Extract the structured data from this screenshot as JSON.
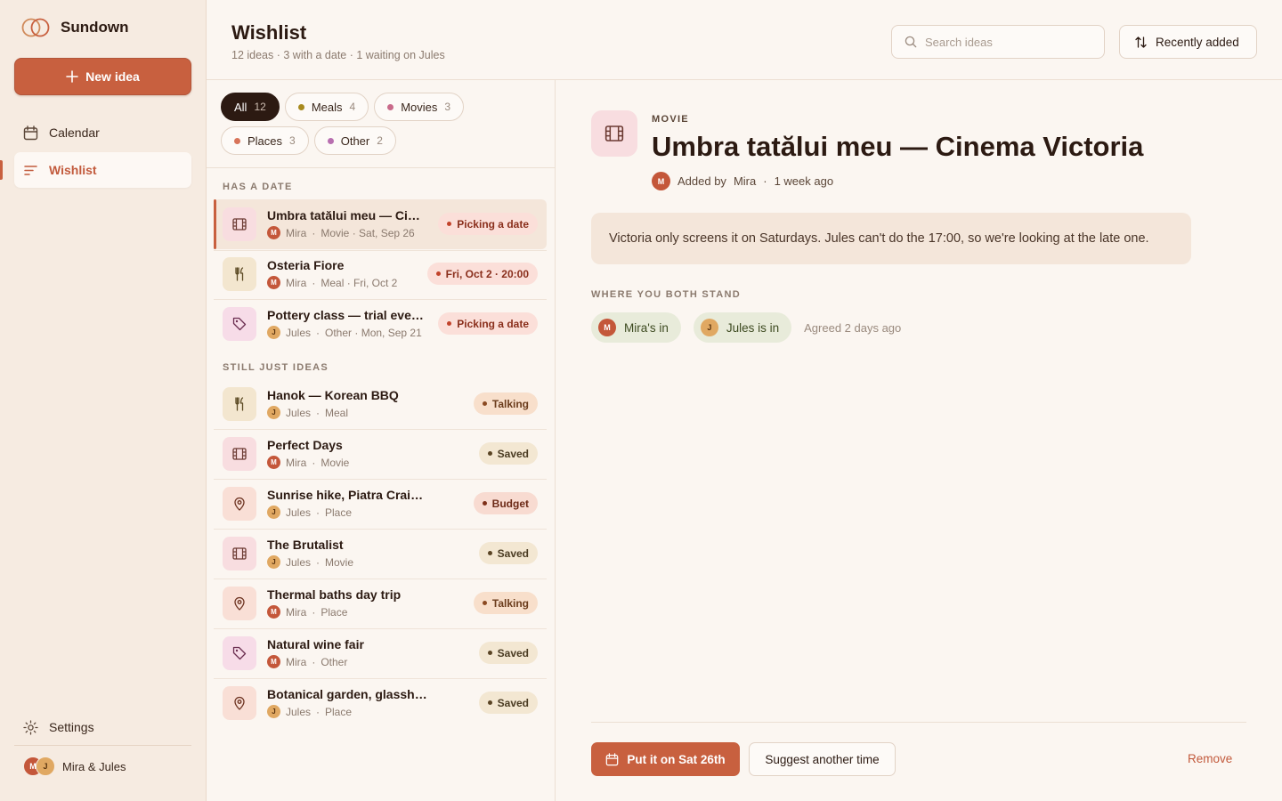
{
  "app": {
    "name": "Sundown"
  },
  "sidebar": {
    "new_button": "New idea",
    "items": [
      {
        "label": "Calendar",
        "icon": "calendar-icon"
      },
      {
        "label": "Wishlist",
        "icon": "list-icon",
        "active": true
      }
    ],
    "settings": "Settings",
    "profile": {
      "name": "Mira & Jules",
      "initials": [
        "M",
        "J"
      ]
    }
  },
  "header": {
    "title": "Wishlist",
    "subtitle": "12 ideas · 3 with a date · 1 waiting on Jules",
    "search_placeholder": "Search ideas",
    "sort_label": "Recently added"
  },
  "filters": [
    {
      "label": "All",
      "count": "12",
      "active": true
    },
    {
      "label": "Meals",
      "count": "4",
      "color": "#a88a1e"
    },
    {
      "label": "Movies",
      "count": "3",
      "color": "#c96a8a"
    },
    {
      "label": "Places",
      "count": "3",
      "color": "#d8745a"
    },
    {
      "label": "Other",
      "count": "2",
      "color": "#b86fb0"
    }
  ],
  "sections": {
    "dated": "HAS A DATE",
    "ideas": "STILL JUST IDEAS"
  },
  "dated_items": [
    {
      "title": "Umbra tatălui meu — Cinema Victoria",
      "initial": "M",
      "who": "Mira",
      "detail": "Movie · Sat, Sep 26",
      "badge": "Picking a date",
      "kind": "movie",
      "selected": true
    },
    {
      "title": "Osteria Fiore",
      "initial": "M",
      "who": "Mira",
      "detail": "Meal · Fri, Oct 2",
      "badge": "Fri, Oct 2 · 20:00",
      "kind": "meal"
    },
    {
      "title": "Pottery class — trial evening",
      "initial": "J",
      "who": "Jules",
      "detail": "Other · Mon, Sep 21",
      "badge": "Picking a date",
      "kind": "other"
    }
  ],
  "idea_items": [
    {
      "title": "Hanok — Korean BBQ",
      "initial": "J",
      "who": "Jules",
      "detail": "Meal",
      "badge": "Talking",
      "kind": "meal"
    },
    {
      "title": "Perfect Days",
      "initial": "M",
      "who": "Mira",
      "detail": "Movie",
      "badge": "Saved",
      "kind": "movie"
    },
    {
      "title": "Sunrise hike, Piatra Craiului",
      "initial": "J",
      "who": "Jules",
      "detail": "Place",
      "badge": "Budget",
      "kind": "place"
    },
    {
      "title": "The Brutalist",
      "initial": "J",
      "who": "Jules",
      "detail": "Movie",
      "badge": "Saved",
      "kind": "movie"
    },
    {
      "title": "Thermal baths day trip",
      "initial": "M",
      "who": "Mira",
      "detail": "Place",
      "badge": "Talking",
      "kind": "place"
    },
    {
      "title": "Natural wine fair",
      "initial": "M",
      "who": "Mira",
      "detail": "Other",
      "badge": "Saved",
      "kind": "other"
    },
    {
      "title": "Botanical garden, glasshouse",
      "initial": "J",
      "who": "Jules",
      "detail": "Place",
      "badge": "Saved",
      "kind": "place"
    }
  ],
  "detail": {
    "type": "MOVIE",
    "title": "Umbra tatălui meu — Cinema Victoria",
    "added_by_label": "Added by",
    "added_by": "Mira",
    "added_initial": "M",
    "added_when": "1 week ago",
    "note": "Victoria only screens it on Saturdays. Jules can't do the 17:00, so we're looking at the late one.",
    "stand_label": "WHERE YOU BOTH STAND",
    "stands": [
      {
        "initial": "M",
        "label": "Mira's in"
      },
      {
        "initial": "J",
        "label": "Jules is in"
      }
    ],
    "agreed": "Agreed 2 days ago",
    "primary_action": "Put it on Sat 26th",
    "secondary_action": "Suggest another time",
    "remove": "Remove"
  },
  "colors": {
    "accent": "#c8603f",
    "ink": "#2c1a12",
    "background": "#fbf6f1"
  }
}
